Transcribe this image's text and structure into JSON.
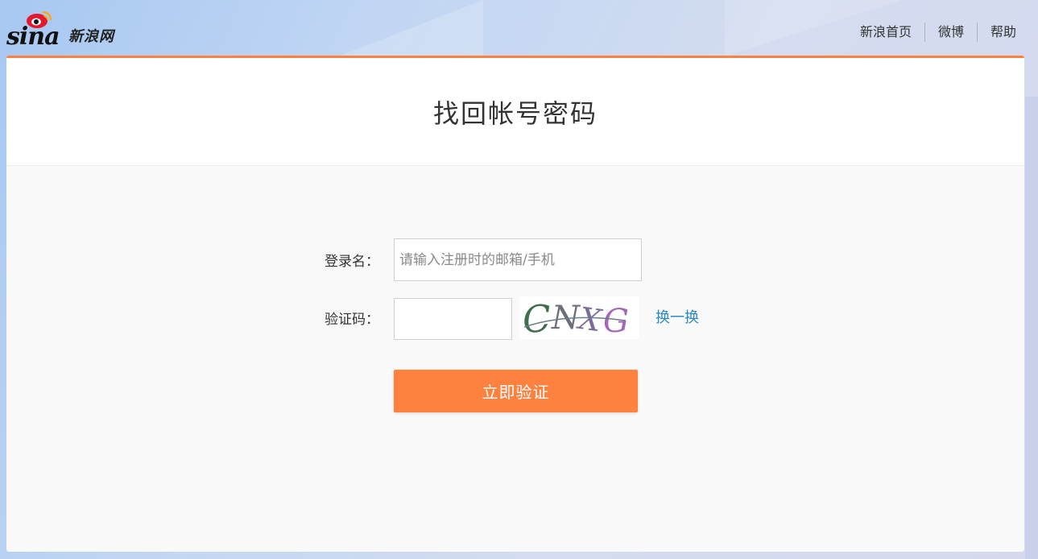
{
  "header": {
    "logo_wordmark": "sina",
    "logo_cn": "新浪网",
    "nav": [
      {
        "label": "新浪首页"
      },
      {
        "label": "微博"
      },
      {
        "label": "帮助"
      }
    ]
  },
  "main": {
    "title": "找回帐号密码",
    "login_label": "登录名：",
    "login_placeholder": "请输入注册时的邮箱/手机",
    "login_value": "",
    "captcha_label": "验证码：",
    "captcha_value": "",
    "captcha_image_text": "CNXG",
    "refresh_label": "换一换",
    "submit_label": "立即验证"
  },
  "colors": {
    "accent": "#ff8140",
    "link": "#2a87c9",
    "logo_red": "#e6162d"
  }
}
